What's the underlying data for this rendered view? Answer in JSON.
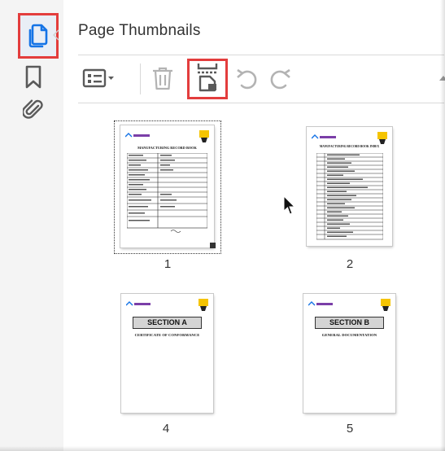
{
  "panel": {
    "title": "Page Thumbnails"
  },
  "rail": {
    "items": [
      {
        "name": "page-thumbnails",
        "icon": "pages-icon",
        "selected": true
      },
      {
        "name": "bookmarks",
        "icon": "bookmark-icon",
        "selected": false
      },
      {
        "name": "attachments",
        "icon": "paperclip-icon",
        "selected": false
      }
    ]
  },
  "toolbar": {
    "options_icon": "thumbnail-options-icon",
    "delete_icon": "trash-icon",
    "extract_icon": "extract-pages-icon",
    "rotate_ccw_icon": "rotate-counterclockwise-icon",
    "rotate_cw_icon": "rotate-clockwise-icon"
  },
  "thumbnails": [
    {
      "page": "1",
      "title": "MANUFACTURING RECORD BOOK",
      "selected": true
    },
    {
      "page": "2",
      "title": "MANUFACTURING RECORD BOOK INDEX",
      "selected": false
    },
    {
      "page": "4",
      "section": "SECTION A",
      "subtitle": "CERTIFICATE OF CONFORMANCE",
      "selected": false
    },
    {
      "page": "5",
      "section": "SECTION B",
      "subtitle": "GENERAL DOCUMENTATION",
      "selected": false
    }
  ],
  "colors": {
    "accent_blue": "#1473e6",
    "highlight_red": "#e33d3d",
    "icon_gray": "#5a5a5a",
    "disabled_gray": "#b3b3b3"
  }
}
